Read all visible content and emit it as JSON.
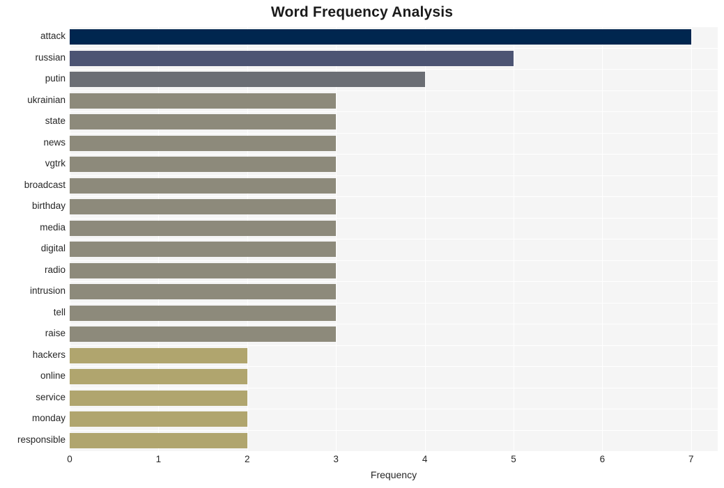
{
  "chart_data": {
    "type": "bar",
    "orientation": "horizontal",
    "title": "Word Frequency Analysis",
    "xlabel": "Frequency",
    "ylabel": "",
    "xlim": [
      0,
      7.3
    ],
    "xticks": [
      0,
      1,
      2,
      3,
      4,
      5,
      6,
      7
    ],
    "xtick_labels": [
      "0",
      "1",
      "2",
      "3",
      "4",
      "5",
      "6",
      "7"
    ],
    "grid": true,
    "legend": false,
    "categories": [
      "attack",
      "russian",
      "putin",
      "ukrainian",
      "state",
      "news",
      "vgtrk",
      "broadcast",
      "birthday",
      "media",
      "digital",
      "radio",
      "intrusion",
      "tell",
      "raise",
      "hackers",
      "online",
      "service",
      "monday",
      "responsible"
    ],
    "values": [
      7,
      5,
      4,
      3,
      3,
      3,
      3,
      3,
      3,
      3,
      3,
      3,
      3,
      3,
      3,
      2,
      2,
      2,
      2,
      2
    ],
    "bar_colors": [
      "#00264f",
      "#4c5473",
      "#6b6e74",
      "#8d8a7b",
      "#8d8a7b",
      "#8d8a7b",
      "#8d8a7b",
      "#8d8a7b",
      "#8d8a7b",
      "#8d8a7b",
      "#8d8a7b",
      "#8d8a7b",
      "#8d8a7b",
      "#8d8a7b",
      "#8d8a7b",
      "#b0a56e",
      "#b0a56e",
      "#b0a56e",
      "#b0a56e",
      "#b0a56e"
    ]
  },
  "style": {
    "plot_background": "#f5f5f5",
    "figure_background": "#ffffff",
    "gridline_color": "#ffffff",
    "text_color": "#262626",
    "title_color": "#1a1a1a"
  }
}
